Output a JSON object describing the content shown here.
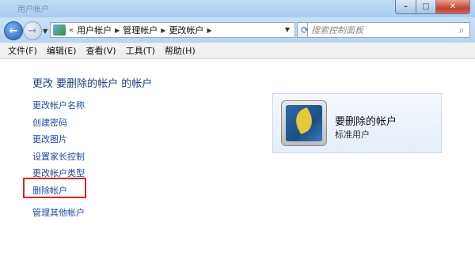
{
  "window": {
    "title": "用户帐户"
  },
  "nav": {
    "breadcrumb_prefix": "«",
    "crumbs": [
      "用户帐户",
      "管理帐户",
      "更改帐户"
    ],
    "search_placeholder": "搜索控制面板"
  },
  "menu": [
    "文件(F)",
    "编辑(E)",
    "查看(V)",
    "工具(T)",
    "帮助(H)"
  ],
  "content": {
    "heading": "更改 要删除的帐户 的帐户",
    "links": [
      "更改帐户名称",
      "创建密码",
      "更改图片",
      "设置家长控制",
      "更改帐户类型",
      "删除帐户",
      "管理其他帐户"
    ],
    "highlighted_link": "删除帐户"
  },
  "user": {
    "name": "要删除的帐户",
    "type": "标准用户"
  },
  "colors": {
    "link": "#1b4da0",
    "heading": "#1e3f86",
    "highlight": "#d9261c"
  }
}
